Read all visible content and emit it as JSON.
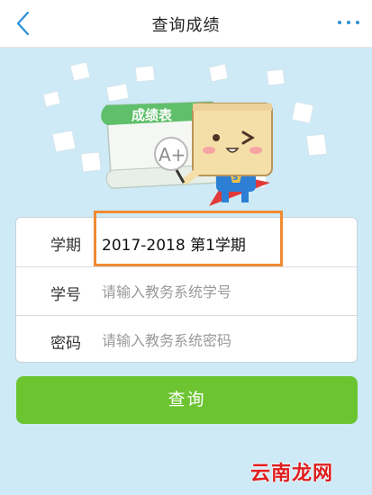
{
  "header": {
    "title": "查询成绩",
    "back_icon": "chevron-left-icon",
    "more_icon": "more-dots-icon",
    "accent_color": "#2b8fd6"
  },
  "hero": {
    "scroll_label": "成绩表",
    "grade_label": "A+",
    "badge_letter": "S"
  },
  "form": {
    "term": {
      "label": "学期",
      "value": "2017-2018 第1学期"
    },
    "student_id": {
      "label": "学号",
      "placeholder": "请输入教务系统学号"
    },
    "password": {
      "label": "密码",
      "placeholder": "请输入教务系统密码"
    }
  },
  "submit": {
    "label": "查询",
    "color": "#6cc431"
  },
  "watermark": {
    "text": "云南龙网",
    "color": "#e01e1e"
  },
  "highlight_color": "#f08a32"
}
